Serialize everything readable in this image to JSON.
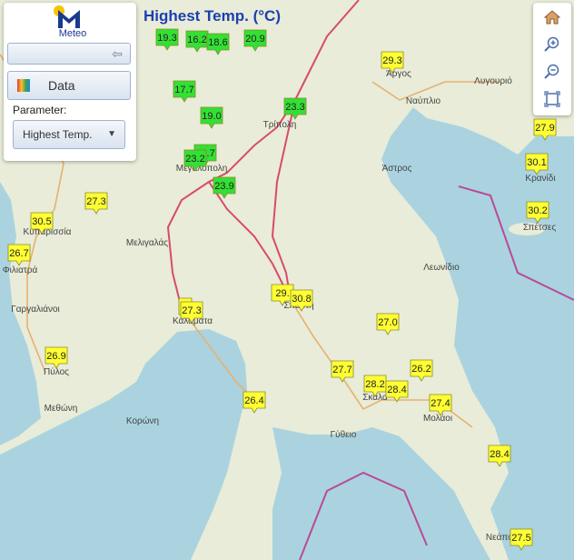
{
  "title": "Highest Temp. (°C)",
  "logo": {
    "text": "Meteo"
  },
  "panel": {
    "data_label": "Data",
    "parameter_label": "Parameter:",
    "parameter_value": "Highest Temp."
  },
  "colors": {
    "title": "#1c3fb0",
    "green": "#33e033",
    "yellow": "#ffff33",
    "road": "#d94a6a",
    "sea": "#aad3df",
    "land": "#e8ecd8"
  },
  "toolbar": [
    "home-icon",
    "zoom-in-icon",
    "zoom-out-icon",
    "zoom-extent-icon"
  ],
  "places": [
    "Άργος",
    "Λυγουριό",
    "Ναύπλιο",
    "Τρίπολη",
    "Μεγαλόπολη",
    "Άστρος",
    "Κρανίδι",
    "Σπέτσες",
    "Κυπαρισσία",
    "Μελιγαλάς",
    "Φιλιατρά",
    "Λεωνίδιο",
    "Γαργαλιάνοι",
    "Καλαμάτα",
    "Σπάρτη",
    "Πύλος",
    "Σκάλα",
    "Μολάοι",
    "Μεθώνη",
    "Κορώνη",
    "Γύθειο",
    "Νεάπολη"
  ],
  "stations": [
    {
      "v": "19.3",
      "c": "green"
    },
    {
      "v": "16.2",
      "c": "green"
    },
    {
      "v": "18.6",
      "c": "green"
    },
    {
      "v": "20.9",
      "c": "green"
    },
    {
      "v": "29.3",
      "c": "yellow"
    },
    {
      "v": "17.7",
      "c": "green"
    },
    {
      "v": "19.0",
      "c": "green"
    },
    {
      "v": "23.3",
      "c": "green"
    },
    {
      "v": "27.9",
      "c": "yellow"
    },
    {
      "v": "22.7",
      "c": "green"
    },
    {
      "v": "23.2",
      "c": "green"
    },
    {
      "v": "30.1",
      "c": "yellow"
    },
    {
      "v": "23.9",
      "c": "green"
    },
    {
      "v": "27.3",
      "c": "yellow"
    },
    {
      "v": "30.2",
      "c": "yellow"
    },
    {
      "v": "30.5",
      "c": "yellow"
    },
    {
      "v": "26.7",
      "c": "yellow"
    },
    {
      "v": "29.",
      "c": "yellow"
    },
    {
      "v": "30.8",
      "c": "yellow"
    },
    {
      "v": "2",
      "c": "yellow"
    },
    {
      "v": "27.3",
      "c": "yellow"
    },
    {
      "v": "27.0",
      "c": "yellow"
    },
    {
      "v": "26.9",
      "c": "yellow"
    },
    {
      "v": "27.7",
      "c": "yellow"
    },
    {
      "v": "26.2",
      "c": "yellow"
    },
    {
      "v": "28.2",
      "c": "yellow"
    },
    {
      "v": "28.4",
      "c": "yellow"
    },
    {
      "v": "26.4",
      "c": "yellow"
    },
    {
      "v": "27.4",
      "c": "yellow"
    },
    {
      "v": "28.4",
      "c": "yellow"
    },
    {
      "v": "27.5",
      "c": "yellow"
    }
  ]
}
